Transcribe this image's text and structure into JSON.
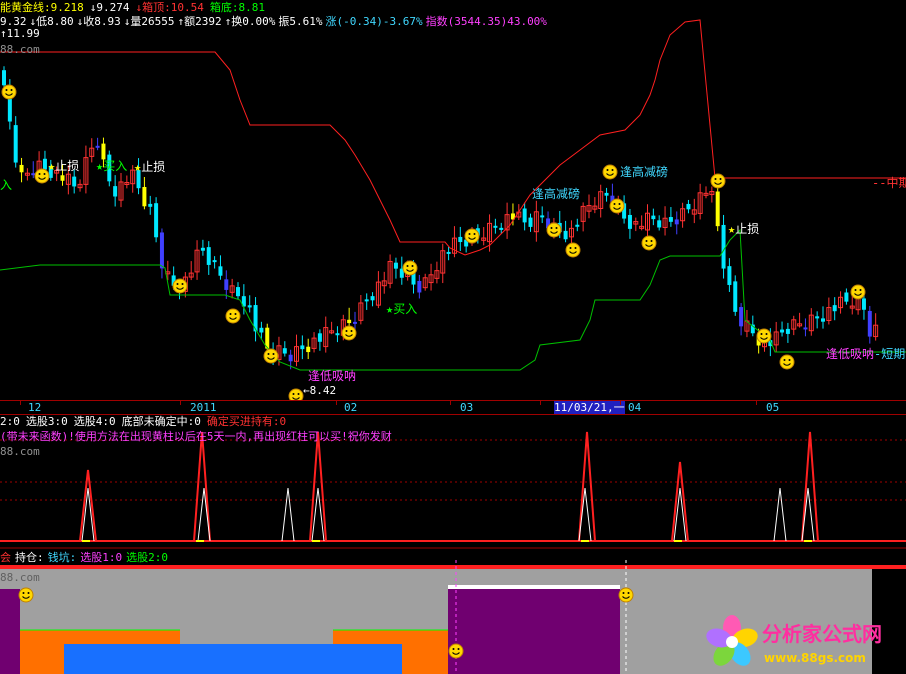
{
  "colors": {
    "up": "#ff3232",
    "down": "#00e8ff",
    "yellow": "#ffff00",
    "green": "#00ff00",
    "magenta": "#ff40ff",
    "cyan": "#40d8ff",
    "white": "#ffffff",
    "divider": "#a00000"
  },
  "header": {
    "row1": [
      {
        "text": "能黄金线:9.218",
        "color": "#ffff00"
      },
      {
        "text": "↓9.274",
        "color": "#ffffff"
      },
      {
        "text": "↓箱顶:10.54",
        "color": "#ff3232"
      },
      {
        "text": "箱底:8.81",
        "color": "#00ff00"
      }
    ],
    "row2": [
      {
        "text": "9.32",
        "color": "#ffffff"
      },
      {
        "text": "↓低8.80",
        "color": "#ffffff"
      },
      {
        "text": "↓收8.93",
        "color": "#ffffff"
      },
      {
        "text": "↓量26555",
        "color": "#ffffff"
      },
      {
        "text": "↑额2392",
        "color": "#ffffff"
      },
      {
        "text": "↑换0.00%",
        "color": "#ffffff"
      },
      {
        "text": "振5.61%",
        "color": "#ffffff"
      },
      {
        "text": "涨(-0.34)-3.67%",
        "color": "#40d8ff"
      },
      {
        "text": "指数(3544.35)43.00%",
        "color": "#ff40ff"
      }
    ],
    "high_label": "11.99",
    "watermark": "88.com"
  },
  "main_annotations": [
    {
      "text": "止损",
      "color": "#ffffff",
      "icon": "star-icon"
    },
    {
      "text": "买入",
      "color": "#00ff00",
      "icon": "star-icon"
    },
    {
      "text": "止损",
      "color": "#ffffff",
      "icon": "star-icon"
    },
    {
      "text": "入",
      "color": "#00ff00",
      "icon": ""
    },
    {
      "text": "买入",
      "color": "#00ff00",
      "icon": "star-icon"
    },
    {
      "text": "逢高减磅",
      "color": "#40d8ff",
      "icon": ""
    },
    {
      "text": "逢高减磅",
      "color": "#40d8ff",
      "icon": ""
    },
    {
      "text": "止损",
      "color": "#ffffff",
      "icon": "star-icon"
    },
    {
      "text": "逢低吸呐",
      "color": "#ff40ff",
      "icon": ""
    },
    {
      "text": "逢低吸呐",
      "color": "#ff40ff",
      "icon": ""
    },
    {
      "text": "--中期",
      "color": "#ff3232",
      "icon": ""
    },
    {
      "text": "-短期",
      "color": "#40d8ff",
      "icon": ""
    }
  ],
  "low_label": "8.42",
  "date_axis": {
    "labels": [
      "12",
      "2011",
      "02",
      "03",
      "04",
      "05"
    ],
    "cursor_date": "11/03/21,一"
  },
  "indicator_panel": {
    "status_row": [
      {
        "text": "2:0",
        "color": "#ffffff"
      },
      {
        "text": "选股3:0",
        "color": "#ffffff"
      },
      {
        "text": "选股4:0",
        "color": "#ffffff"
      },
      {
        "text": "底部未确定中:0",
        "color": "#ffffff"
      },
      {
        "text": "确定买进持有:0",
        "color": "#ff3232"
      }
    ],
    "note": "(带未来函数)!使用方法在出现黄柱以后在5天一内,再出现红柱可以买!祝你发财",
    "watermark": "88.com"
  },
  "position_panel": {
    "status_row": [
      {
        "text": "会",
        "color": "#ff3232"
      },
      {
        "text": "持仓:",
        "color": "#ffffff"
      },
      {
        "text": "钱坑:",
        "color": "#40d8ff"
      },
      {
        "text": "选股1:0",
        "color": "#ff40ff"
      },
      {
        "text": "选股2:0",
        "color": "#00ff00"
      }
    ],
    "watermark": "88.com"
  },
  "logo": {
    "title": "分析家公式网",
    "url": "www.88gs.com"
  }
}
